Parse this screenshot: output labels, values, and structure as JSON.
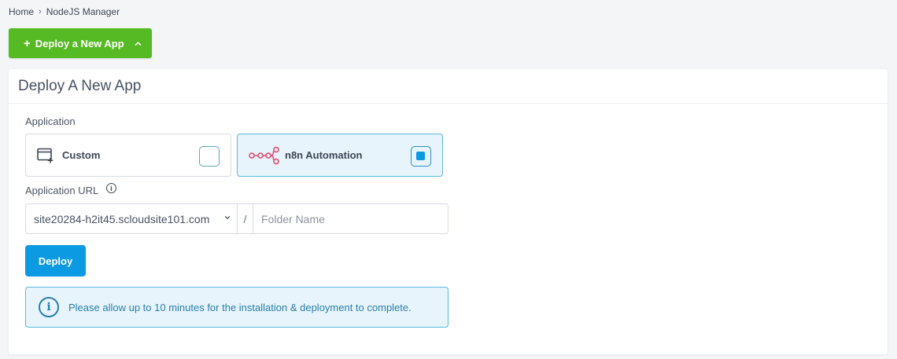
{
  "breadcrumb": {
    "home": "Home",
    "separator": "›",
    "current": "NodeJS Manager"
  },
  "toggle_button": {
    "plus": "+",
    "label": "Deploy a New App"
  },
  "card": {
    "title": "Deploy A New App"
  },
  "application": {
    "label": "Application",
    "options": [
      {
        "label": "Custom",
        "icon": "custom-app-icon",
        "selected": false
      },
      {
        "label": "n8n Automation",
        "icon": "n8n-logo-icon",
        "selected": true
      }
    ]
  },
  "url": {
    "label": "Application URL",
    "info_glyph": "i",
    "domain_value": "site20284-h2it45.scloudsite101.com",
    "separator": "/",
    "folder_placeholder": "Folder Name"
  },
  "deploy_button": {
    "label": "Deploy"
  },
  "notice": {
    "glyph": "i",
    "text": "Please allow up to 10 minutes for the installation & deployment to complete."
  },
  "colors": {
    "green": "#56ba24",
    "blue": "#0c9ae3",
    "selected_bg": "#e7f4fb",
    "selected_border": "#5ab9dd",
    "n8n_pink": "#e5577a"
  }
}
